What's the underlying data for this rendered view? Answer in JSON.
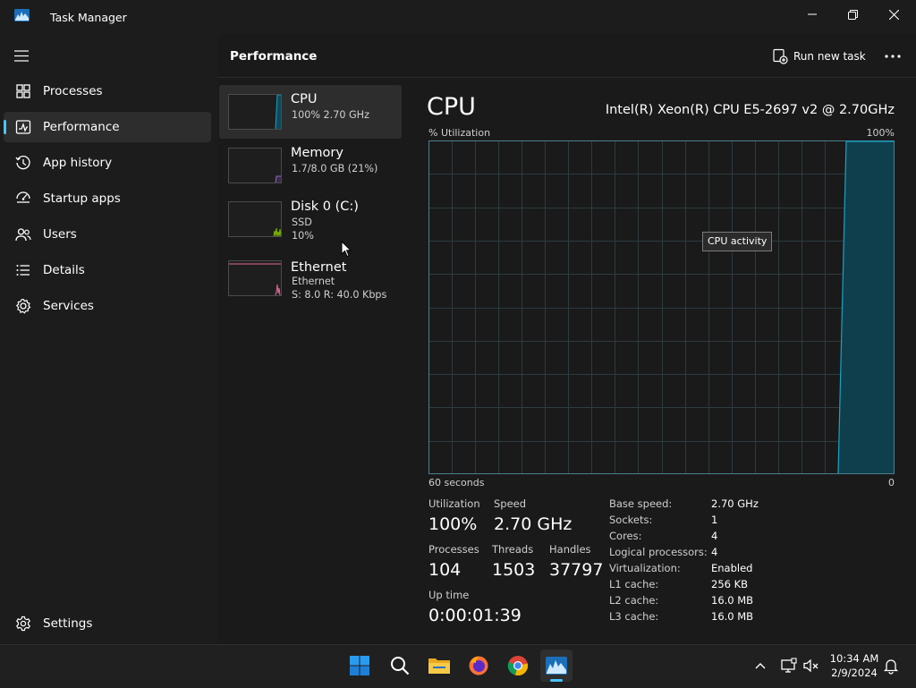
{
  "window": {
    "title": "Task Manager"
  },
  "sidebar": {
    "items": [
      {
        "label": "Processes",
        "icon": "processes-icon"
      },
      {
        "label": "Performance",
        "icon": "performance-icon",
        "active": true
      },
      {
        "label": "App history",
        "icon": "history-icon"
      },
      {
        "label": "Startup apps",
        "icon": "startup-icon"
      },
      {
        "label": "Users",
        "icon": "users-icon"
      },
      {
        "label": "Details",
        "icon": "details-icon"
      },
      {
        "label": "Services",
        "icon": "services-icon"
      }
    ],
    "settings_label": "Settings"
  },
  "header": {
    "title": "Performance",
    "run_task_label": "Run new task"
  },
  "devices": [
    {
      "name": "CPU",
      "sub1": "100% 2.70 GHz",
      "active": true
    },
    {
      "name": "Memory",
      "sub1": "1.7/8.0 GB (21%)"
    },
    {
      "name": "Disk 0 (C:)",
      "sub1": "SSD",
      "sub2": "10%"
    },
    {
      "name": "Ethernet",
      "sub1": "Ethernet",
      "sub2": "S: 8.0 R: 40.0 Kbps"
    }
  ],
  "cpu": {
    "title": "CPU",
    "model": "Intel(R) Xeon(R) CPU E5-2697 v2 @ 2.70GHz",
    "graph": {
      "y_label": "% Utilization",
      "y_max_label": "100%",
      "x_left_label": "60 seconds",
      "x_right_label": "0",
      "tooltip": "CPU activity"
    },
    "stats": {
      "utilization_label": "Utilization",
      "utilization": "100%",
      "speed_label": "Speed",
      "speed": "2.70 GHz",
      "processes_label": "Processes",
      "processes": "104",
      "threads_label": "Threads",
      "threads": "1503",
      "handles_label": "Handles",
      "handles": "37797",
      "uptime_label": "Up time",
      "uptime": "0:00:01:39"
    },
    "specs": [
      {
        "label": "Base speed:",
        "value": "2.70 GHz"
      },
      {
        "label": "Sockets:",
        "value": "1"
      },
      {
        "label": "Cores:",
        "value": "4"
      },
      {
        "label": "Logical processors:",
        "value": "4"
      },
      {
        "label": "Virtualization:",
        "value": "Enabled"
      },
      {
        "label": "L1 cache:",
        "value": "256 KB"
      },
      {
        "label": "L2 cache:",
        "value": "16.0 MB"
      },
      {
        "label": "L3 cache:",
        "value": "16.0 MB"
      }
    ]
  },
  "taskbar": {
    "icons": [
      "windows-start-icon",
      "search-icon",
      "file-explorer-icon",
      "firefox-icon",
      "chrome-icon",
      "task-manager-icon"
    ],
    "time": "10:34 AM",
    "date": "2/9/2024"
  },
  "colors": {
    "accent": "#4cc2ff",
    "cpu_graph": "#17a2c8",
    "disk_graph": "#7fba00",
    "ethernet_graph": "#e5689e"
  }
}
